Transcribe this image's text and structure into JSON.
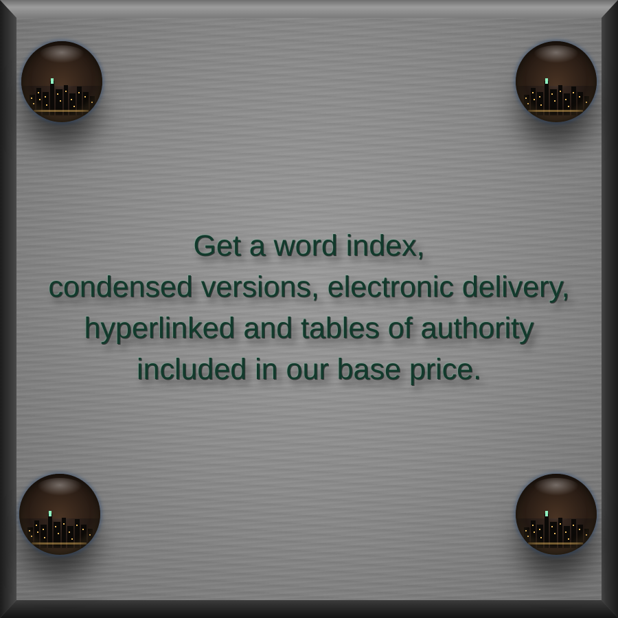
{
  "message": {
    "lines": [
      "Get a word index,",
      "condensed versions, electronic delivery,",
      "hyperlinked and tables of authority",
      "included in our base price."
    ]
  },
  "colors": {
    "text": "#123a2c",
    "plaque": "#8a8a8a",
    "frame_dark": "#1c1c1c"
  },
  "icons": {
    "corners": "glass-sphere-city-icon"
  }
}
